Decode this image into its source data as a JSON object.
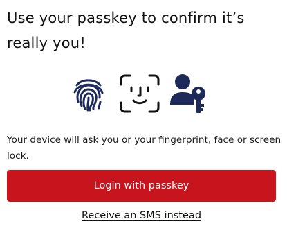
{
  "title": "Use your passkey to confirm it’s really you!",
  "icons": [
    {
      "name": "fingerprint-icon",
      "color": "#1e2a5a"
    },
    {
      "name": "face-id-icon",
      "color": "#111111"
    },
    {
      "name": "user-key-icon",
      "color": "#1e2a5a"
    }
  ],
  "description": "Your device will ask you or your fingerprint, face or screen lock.",
  "login_button": {
    "label": "Login with passkey",
    "color": "#c8141c"
  },
  "sms_link": {
    "label": "Receive an SMS instead"
  }
}
